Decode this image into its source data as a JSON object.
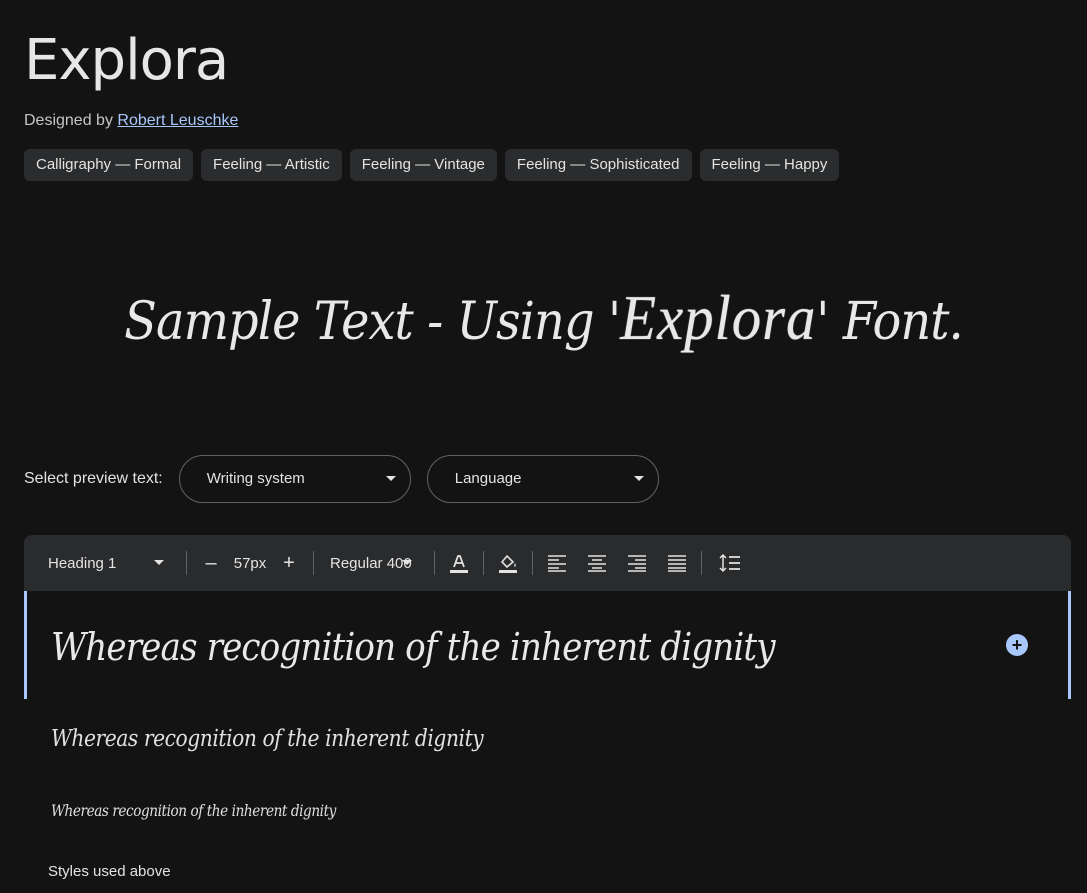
{
  "font": {
    "name": "Explora",
    "designed_by_label": "Designed by",
    "designer": "Robert Leuschke"
  },
  "tags": [
    "Calligraphy — Formal",
    "Feeling — Artistic",
    "Feeling — Vintage",
    "Feeling — Sophisticated",
    "Feeling — Happy"
  ],
  "sample_text": {
    "before": "Sample Text - Using '",
    "highlight": "Explora",
    "after": "' Font."
  },
  "preview": {
    "label": "Select preview text:",
    "writing_system": "Writing system",
    "language": "Language"
  },
  "toolbar": {
    "style": "Heading 1",
    "size": "57px",
    "weight": "Regular 400",
    "decrease_glyph": "–",
    "increase_glyph": "+"
  },
  "preview_lines": [
    "Whereas recognition of the inherent dignity",
    "Whereas recognition of the inherent dignity",
    "Whereas recognition of the inherent dignity"
  ],
  "styles_used_label": "Styles used above",
  "colors": {
    "background": "#131314",
    "accent": "#a8c7fa",
    "chip": "#2b2c2e",
    "toolbar": "#2a2b2d"
  },
  "icons": [
    "text-color-icon",
    "highlight-color-icon",
    "align-left-icon",
    "align-center-icon",
    "align-right-icon",
    "align-justify-icon",
    "line-spacing-icon",
    "add-icon"
  ]
}
